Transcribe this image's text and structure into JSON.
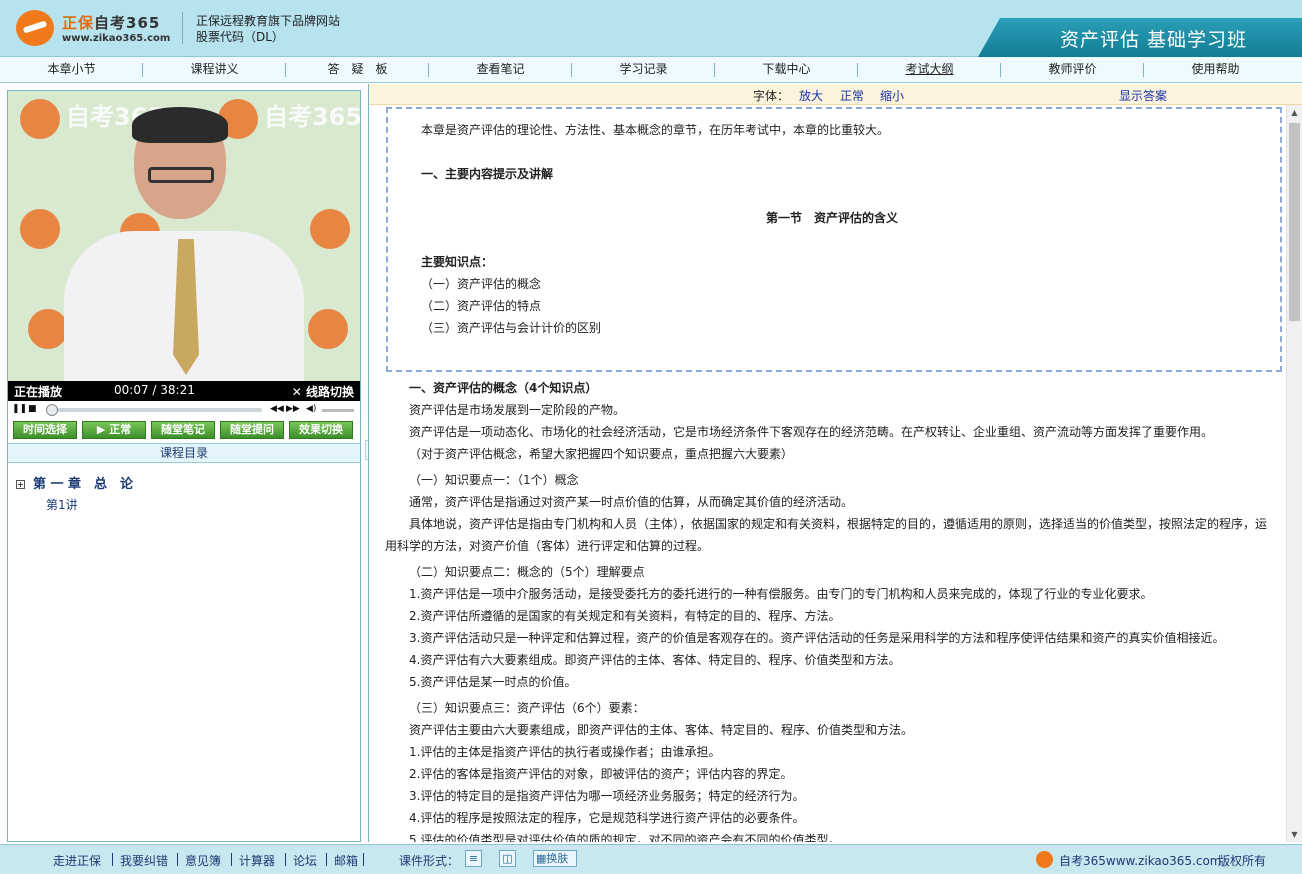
{
  "header": {
    "logo_name_a": "正保",
    "logo_name_b": "自考365",
    "logo_url": "www.zikao365.com",
    "brand_line1": "正保远程教育旗下品牌网站",
    "brand_line2": "股票代码（DL）",
    "course_title": "资产评估 基础学习班"
  },
  "nav": {
    "items": [
      "本章小节",
      "课程讲义",
      "答　疑　板",
      "查看笔记",
      "学习记录",
      "下载中心",
      "考试大纲",
      "教师评价",
      "使用帮助"
    ]
  },
  "video": {
    "bg_logo": "自考365",
    "bg_url": "www.zikao365.com",
    "state": "正在播放",
    "time": "00:07 / 38:21",
    "switch_label": "线路切换"
  },
  "player_buttons": [
    "时间选择",
    "正常",
    "随堂笔记",
    "随堂提问",
    "效果切换"
  ],
  "catalog": {
    "title": "课程目录",
    "chapter": "第 一 章　总　论",
    "lesson": "第1讲"
  },
  "toolbar": {
    "font_label": "字体：",
    "enlarge": "放大",
    "normal": "正常",
    "shrink": "缩小",
    "show_answer": "显示答案"
  },
  "content": {
    "intro": "本章是资产评估的理论性、方法性、基本概念的章节，在历年考试中，本章的比重较大。",
    "main_heading": "一、主要内容提示及讲解",
    "section_title": "第一节　资产评估的含义",
    "kp_label": "主要知识点：",
    "kp1": "（一）资产评估的概念",
    "kp2": "（二）资产评估的特点",
    "kp3": "（三）资产评估与会计计价的区别",
    "h1": "一、资产评估的概念（4个知识点）",
    "l1": "资产评估是市场发展到一定阶段的产物。",
    "l2": "资产评估是一项动态化、市场化的社会经济活动，它是市场经济条件下客观存在的经济范畴。在产权转让、企业重组、资产流动等方面发挥了重要作用。",
    "l3": "（对于资产评估概念，希望大家把握四个知识要点，重点把握六大要素）",
    "kp_one": "（一）知识要点一：（1个）概念",
    "l4": "通常，资产评估是指通过对资产某一时点价值的估算，从而确定其价值的经济活动。",
    "l5a": "具体地说，资产评估是指由专门机构和人员（主体），依据国家的规定和有关资料，根据特定的目的，遵循适用的原则，选择适当的价值类型，按照法定的程序，运",
    "l5b": "用科学的方法，对资产价值（客体）进行评定和估算的过程。",
    "kp_two": "（二）知识要点二：概念的（5个）理解要点",
    "p1": "1.资产评估是一项中介服务活动，是接受委托方的委托进行的一种有偿服务。由专门的专门机构和人员来完成的，体现了行业的专业化要求。",
    "p2": "2.资产评估所遵循的是国家的有关规定和有关资料，有特定的目的、程序、方法。",
    "p3": "3.资产评估活动只是一种评定和估算过程，资产的价值是客观存在的。资产评估活动的任务是采用科学的方法和程序使评估结果和资产的真实价值相接近。",
    "p4": "4.资产评估有六大要素组成。即资产评估的主体、客体、特定目的、程序、价值类型和方法。",
    "p5": "5.资产评估是某一时点的价值。",
    "kp_three": "（三）知识要点三：资产评估（6个）要素：",
    "l6": "资产评估主要由六大要素组成，即资产评估的主体、客体、特定目的、程序、价值类型和方法。",
    "e1": "1.评估的主体是指资产评估的执行者或操作者；由谁承担。",
    "e2": "2.评估的客体是指资产评估的对象，即被评估的资产；评估内容的界定。",
    "e3": "3.评估的特定目的是指资产评估为哪一项经济业务服务；特定的经济行为。",
    "e4": "4.评估的程序是按照法定的程序，它是规范科学进行资产评估的必要条件。",
    "e5": "5.评估的价值类型是对评估价值的质的规定，对不同的资产会有不同的价值类型。"
  },
  "footer": {
    "links": [
      "走进正保",
      "我要纠错",
      "意见簿",
      "计算器",
      "论坛",
      "邮箱"
    ],
    "mode_label": "课件形式：",
    "skin_label": "换肤",
    "site": "自考365www.zikao365.com",
    "copyright": "版权所有"
  }
}
